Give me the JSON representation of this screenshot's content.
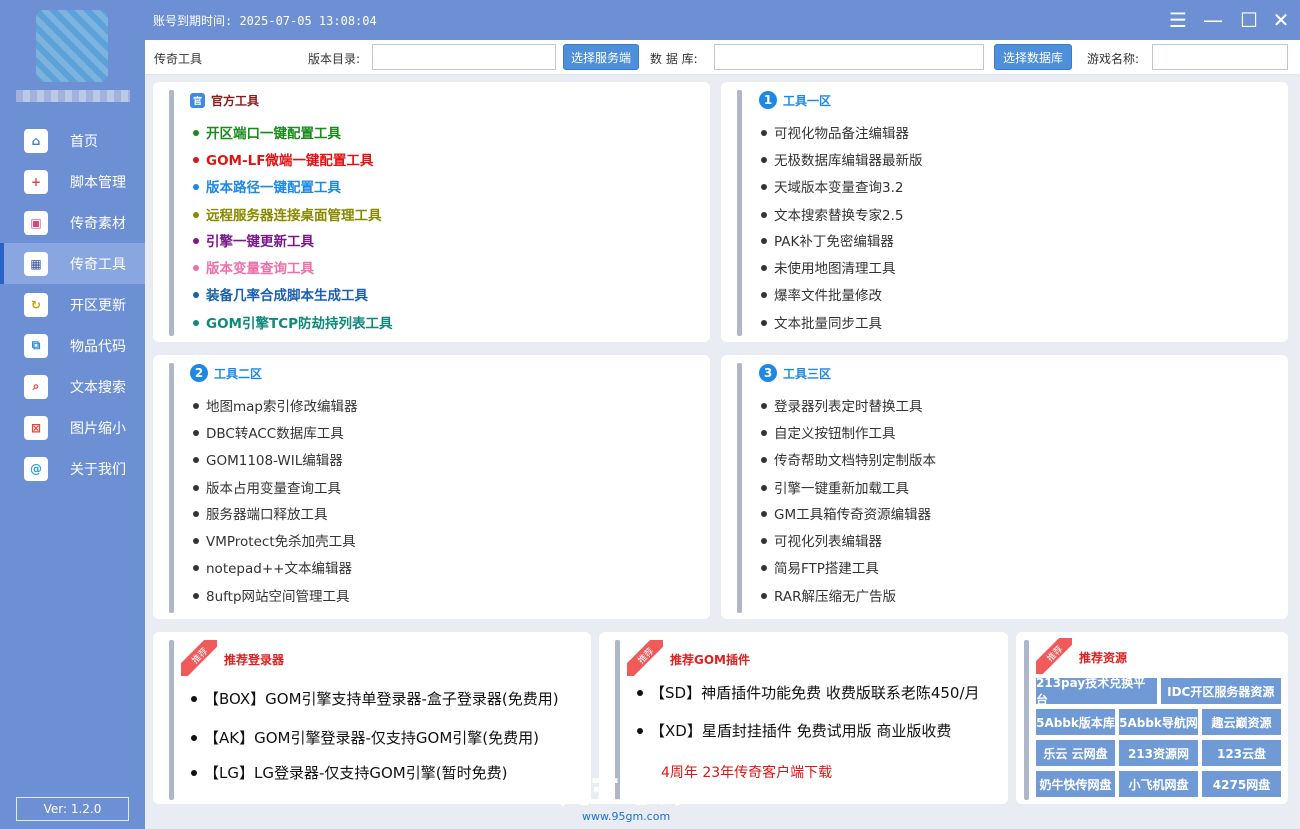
{
  "titlebar": {
    "expiry": "账号到期时间: 2025-07-05 13:08:04",
    "menu_icon": "☰",
    "min_icon": "—",
    "max_icon": "☐",
    "close_icon": "✕"
  },
  "sidebar": {
    "items": [
      {
        "label": "首页",
        "icon": "home-icon",
        "glyph": "⌂",
        "color": "#3a7bd5"
      },
      {
        "label": "脚本管理",
        "icon": "script-icon",
        "glyph": "+",
        "color": "#e04a4a"
      },
      {
        "label": "传奇素材",
        "icon": "image-icon",
        "glyph": "▣",
        "color": "#d6457c"
      },
      {
        "label": "传奇工具",
        "icon": "grid-icon",
        "glyph": "▦",
        "color": "#2f4f9f"
      },
      {
        "label": "开区更新",
        "icon": "refresh-icon",
        "glyph": "↻",
        "color": "#c9a100"
      },
      {
        "label": "物品代码",
        "icon": "code-icon",
        "glyph": "⧉",
        "color": "#2a8bd8"
      },
      {
        "label": "文本搜索",
        "icon": "search-icon",
        "glyph": "⌕",
        "color": "#e0463c"
      },
      {
        "label": "图片缩小",
        "icon": "shrink-icon",
        "glyph": "⊠",
        "color": "#e0463c"
      },
      {
        "label": "关于我们",
        "icon": "at-icon",
        "glyph": "@",
        "color": "#2aa0e0"
      }
    ],
    "version": "Ver: 1.2.0"
  },
  "toolbar": {
    "section": "传奇工具",
    "version_dir_label": "版本目录:",
    "version_dir_value": "",
    "select_server": "选择服务端",
    "database_label": "数 据 库:",
    "database_value": "",
    "select_db": "选择数据库",
    "game_name_label": "游戏名称:",
    "game_name_value": ""
  },
  "official": {
    "title": "官方工具",
    "badge": "官",
    "items": [
      {
        "label": "开区端口一键配置工具",
        "color": "#1a8a1a"
      },
      {
        "label": "GOM-LF微端一键配置工具",
        "color": "#e01414"
      },
      {
        "label": "版本路径一键配置工具",
        "color": "#1e88e5"
      },
      {
        "label": "远程服务器连接桌面管理工具",
        "color": "#8a8a00"
      },
      {
        "label": "引擎一键更新工具",
        "color": "#7a1a8a"
      },
      {
        "label": "版本变量查询工具",
        "color": "#f06fa8"
      },
      {
        "label": "装备几率合成脚本生成工具",
        "color": "#1a5fb0"
      },
      {
        "label": "GOM引擎TCP防劫持列表工具",
        "color": "#0f8a7a"
      }
    ]
  },
  "zone1": {
    "badge": "1",
    "title": "工具一区",
    "items": [
      "可视化物品备注编辑器",
      "无极数据库编辑器最新版",
      "天域版本变量查询3.2",
      "文本搜索替换专家2.5",
      "PAK补丁免密编辑器",
      "未使用地图清理工具",
      "爆率文件批量修改",
      "文本批量同步工具"
    ]
  },
  "zone2": {
    "badge": "2",
    "title": "工具二区",
    "items": [
      "地图map索引修改编辑器",
      "DBC转ACC数据库工具",
      "GOM1108-WIL编辑器",
      "版本占用变量查询工具",
      "服务器端口释放工具",
      "VMProtect免杀加壳工具",
      "notepad++文本编辑器",
      "8uftp网站空间管理工具"
    ]
  },
  "zone3": {
    "badge": "3",
    "title": "工具三区",
    "items": [
      "登录器列表定时替换工具",
      "自定义按钮制作工具",
      "传奇帮助文档特别定制版本",
      "引擎一键重新加载工具",
      "GM工具箱传奇资源编辑器",
      "可视化列表编辑器",
      "简易FTP搭建工具",
      "RAR解压缩无广告版"
    ]
  },
  "rec_login": {
    "ribbon": "推荐",
    "title": "推荐登录器",
    "items": [
      "【BOX】GOM引擎支持单登录器-盒子登录器(免费用)",
      "【AK】GOM引擎登录器-仅支持GOM引擎(免费用)",
      "【LG】LG登录器-仅支持GOM引擎(暂时免费)"
    ]
  },
  "rec_plugin": {
    "ribbon": "推荐",
    "title": "推荐GOM插件",
    "items": [
      "【SD】神盾插件功能免费 收费版联系老陈450/月",
      "【XD】星盾封挂插件 免费试用版 商业版收费"
    ],
    "red_link": "4周年 23年传奇客户端下载"
  },
  "rec_res": {
    "ribbon": "推荐",
    "title": "推荐资源",
    "buttons": [
      [
        "213pay技术兑换平台",
        "IDC开区服务器资源"
      ],
      [
        "5Abbk版本库",
        "5Abbk导航网",
        "趣云巅资源"
      ],
      [
        "乐云 云网盘",
        "213资源网",
        "123云盘"
      ],
      [
        "奶牛快传网盘",
        "小飞机网盘",
        "4275网盘"
      ]
    ]
  },
  "watermark": {
    "main": "九五论坛",
    "sub": "www.95gm.com"
  }
}
